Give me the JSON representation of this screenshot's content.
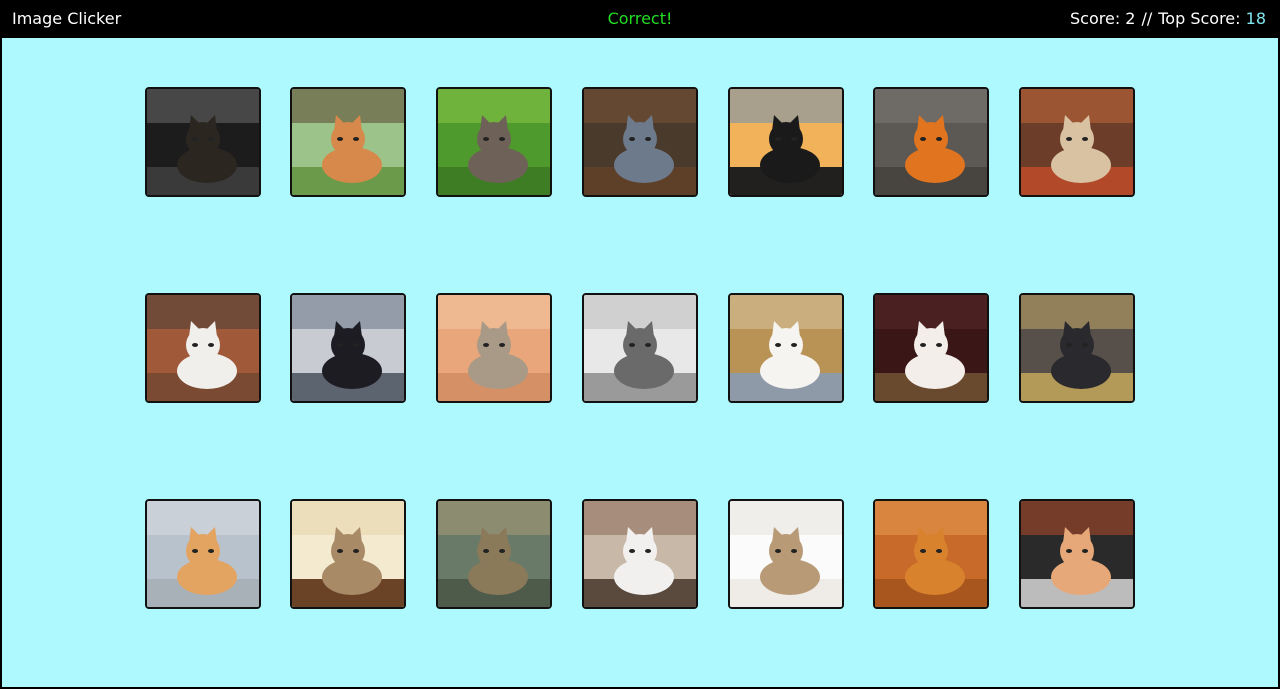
{
  "header": {
    "brand": "Image Clicker",
    "message": "Correct!",
    "score_label": "Score: 2",
    "separator": "//",
    "top_score_label": "Top Score:",
    "top_score_value": "18"
  },
  "colors": {
    "navbar_bg": "#000000",
    "board_bg": "#adf9fd",
    "message_color": "#22dd22",
    "top_score_color": "#7fe6ef"
  },
  "tiles": [
    {
      "name": "tile-cat-peeking-tree",
      "bg": "#1c1c1c",
      "accent": "#6b6b6b",
      "cat": "#2b2620",
      "ground": "#3a3a3a"
    },
    {
      "name": "tile-kitten-in-tree",
      "bg": "#9cc48a",
      "accent": "#5a4630",
      "cat": "#d6894a",
      "ground": "#6a9a4a"
    },
    {
      "name": "tile-kitten-in-grass",
      "bg": "#4f9a2c",
      "accent": "#8cc84a",
      "cat": "#6e6258",
      "ground": "#3e7d24"
    },
    {
      "name": "tile-kittens-in-basket",
      "bg": "#4a3a2c",
      "accent": "#7a5436",
      "cat": "#6c7a8c",
      "ground": "#5e4028"
    },
    {
      "name": "tile-sunset-jumper",
      "bg": "#f2b25a",
      "accent": "#6c8fb6",
      "cat": "#1a1a1a",
      "ground": "#22201e"
    },
    {
      "name": "tile-kitten-on-rock",
      "bg": "#5c5854",
      "accent": "#7e7a74",
      "cat": "#e0741f",
      "ground": "#48443f"
    },
    {
      "name": "tile-cat-in-pot",
      "bg": "#6c3d28",
      "accent": "#c26a3a",
      "cat": "#d9c2a2",
      "ground": "#b24a2a"
    },
    {
      "name": "tile-tabby-white-cat",
      "bg": "#a05a3a",
      "accent": "#4a4036",
      "cat": "#f0efec",
      "ground": "#7a4a32"
    },
    {
      "name": "tile-kitten-with-flower",
      "bg": "#c8ccd2",
      "accent": "#6a7486",
      "cat": "#1c1c22",
      "ground": "#5c6470"
    },
    {
      "name": "tile-scottish-fold-sitting",
      "bg": "#e8a67a",
      "accent": "#f2c7a3",
      "cat": "#a89a86",
      "ground": "#d69066"
    },
    {
      "name": "tile-bw-cat-face",
      "bg": "#e8e8e8",
      "accent": "#bbbbbb",
      "cat": "#6a6a6a",
      "ground": "#9a9a9a"
    },
    {
      "name": "tile-white-kitten-lying",
      "bg": "#b99256",
      "accent": "#d9c4a0",
      "cat": "#f6f4f0",
      "ground": "#8e9aa8"
    },
    {
      "name": "tile-white-kitten-dark",
      "bg": "#3a1616",
      "accent": "#5a2a2a",
      "cat": "#f4eeea",
      "ground": "#6a4a2e"
    },
    {
      "name": "tile-kittens-in-straw",
      "bg": "#57504a",
      "accent": "#c2a868",
      "cat": "#2a2a2e",
      "ground": "#b39a58"
    },
    {
      "name": "tile-orange-kitten",
      "bg": "#b8c2cc",
      "accent": "#d8dde2",
      "cat": "#e3a462",
      "ground": "#a8b0b8"
    },
    {
      "name": "tile-kitten-looking-up",
      "bg": "#f4ead0",
      "accent": "#e6d4a8",
      "cat": "#a98a66",
      "ground": "#6a4226"
    },
    {
      "name": "tile-cat-with-glasses",
      "bg": "#6a7a68",
      "accent": "#a89a78",
      "cat": "#8a7a5a",
      "ground": "#4e5a4a"
    },
    {
      "name": "tile-yawning-cat",
      "bg": "#c8b8a8",
      "accent": "#8a6a58",
      "cat": "#f2f0ee",
      "ground": "#5a4a3e"
    },
    {
      "name": "tile-tabby-on-white",
      "bg": "#fbfbfb",
      "accent": "#e8e4de",
      "cat": "#b89a76",
      "ground": "#efece8"
    },
    {
      "name": "tile-orange-cat-eye",
      "bg": "#c86a2a",
      "accent": "#e89a50",
      "cat": "#d9822e",
      "ground": "#a8561e"
    },
    {
      "name": "tile-sleeping-orange-kitten",
      "bg": "#2a2a2a",
      "accent": "#b24a2a",
      "cat": "#e6a878",
      "ground": "#bcbcbc"
    }
  ]
}
